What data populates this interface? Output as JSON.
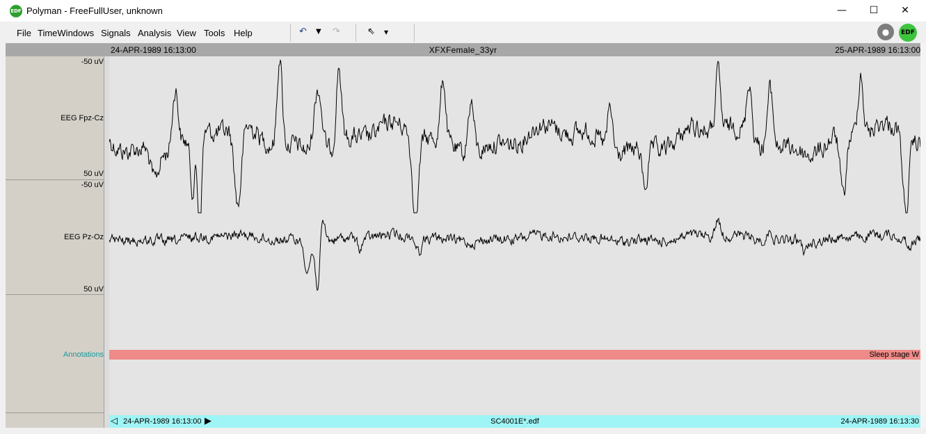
{
  "window": {
    "title": "Polyman - FreeFullUser, unknown",
    "logo_icon": "edf-logo-icon",
    "minimize_glyph": "—",
    "maximize_glyph": "☐",
    "close_glyph": "✕"
  },
  "menu": {
    "items": [
      {
        "label": "File"
      },
      {
        "label": "TimeWindows"
      },
      {
        "label": "Signals"
      },
      {
        "label": "Analysis"
      },
      {
        "label": "View"
      },
      {
        "label": "Tools"
      },
      {
        "label": "Help"
      }
    ]
  },
  "toolbar": {
    "undo_icon": "undo-icon",
    "undo_dropdown_icon": "chevron-down-icon",
    "redo_icon": "redo-icon",
    "pointer_icon": "cursor-arrow-icon",
    "pointer_dropdown_icon": "chevron-down-icon",
    "record_icon": "record-camera-icon",
    "edf_badge": "EDF"
  },
  "header": {
    "start_time": "24-APR-1989 16:13:00",
    "subject": "XFXFemale_33yr",
    "end_time": "25-APR-1989 16:13:00"
  },
  "channels": [
    {
      "name": "EEG Fpz-Cz",
      "scale_top": "-50 uV",
      "scale_bottom": "50 uV"
    },
    {
      "name": "EEG Pz-Oz",
      "scale_top": "-50 uV",
      "scale_bottom": "50 uV"
    }
  ],
  "annotations": {
    "label": "Annotations",
    "event_text": "Sleep stage W",
    "band_color": "#ee8a88"
  },
  "status": {
    "window_start": "24-APR-1989 16:13:00",
    "file_name": "SC4001E*.edf",
    "window_end": "24-APR-1989 16:13:30",
    "prev_icon": "triangle-left-icon",
    "next_icon": "triangle-right-icon"
  },
  "colors": {
    "plot_background": "#e4e4e4",
    "status_bar": "#9ff5f5",
    "annotation_label": "#1a9a9a",
    "trace": "#000000"
  }
}
